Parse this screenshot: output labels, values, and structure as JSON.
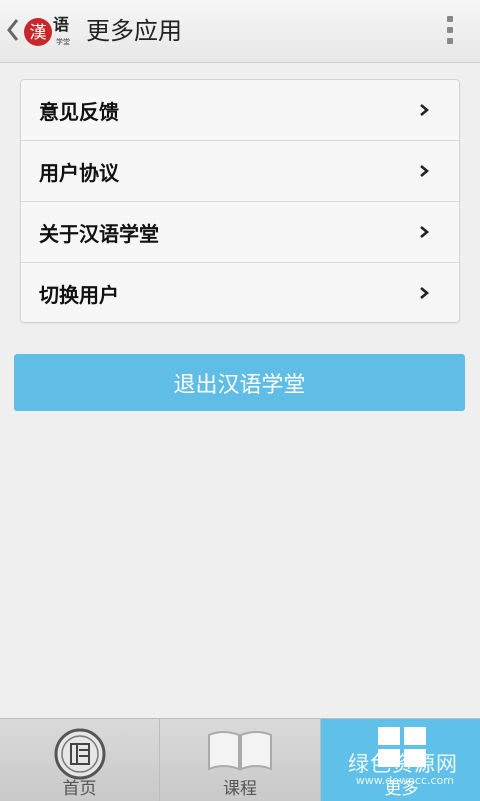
{
  "header": {
    "title": "更多应用",
    "logo_main": "漢",
    "logo_side": "语",
    "logo_small": "学堂"
  },
  "menu": {
    "items": [
      {
        "label": "意见反馈"
      },
      {
        "label": "用户协议"
      },
      {
        "label": "关于汉语学堂"
      },
      {
        "label": "切换用户"
      }
    ]
  },
  "logout_button": {
    "label": "退出汉语学堂"
  },
  "tabs": [
    {
      "label": "首页",
      "icon": "home-icon",
      "active": false
    },
    {
      "label": "课程",
      "icon": "book-icon",
      "active": false
    },
    {
      "label": "更多",
      "icon": "grid-icon",
      "active": true
    }
  ],
  "watermark": {
    "text": "绿色资源网",
    "sub": "www.downcc.com"
  },
  "colors": {
    "accent": "#5fbde6",
    "background": "#efefef",
    "tabbar": "#cfcfcf"
  }
}
